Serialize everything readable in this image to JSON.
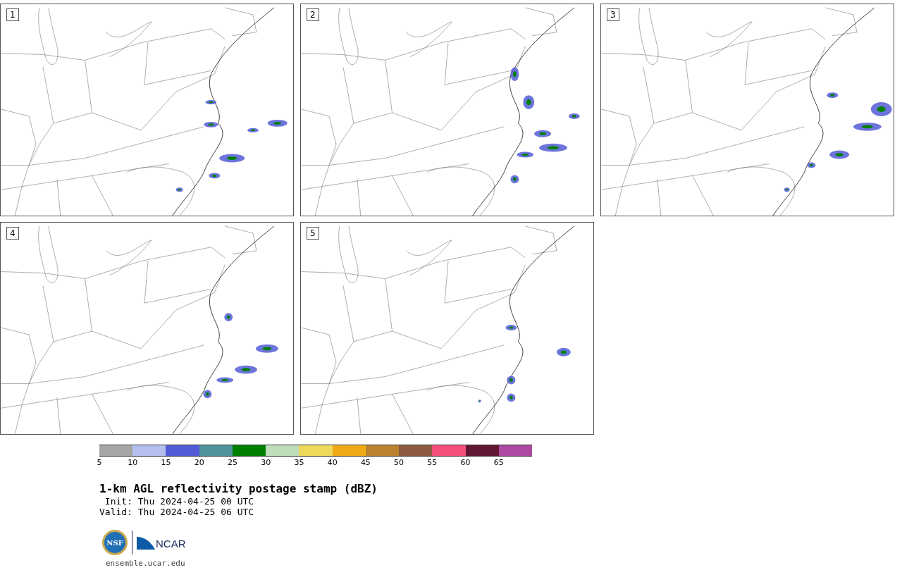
{
  "panels": [
    {
      "label": "1"
    },
    {
      "label": "2"
    },
    {
      "label": "3"
    },
    {
      "label": "4"
    },
    {
      "label": "5"
    }
  ],
  "colorbar": {
    "segments": [
      {
        "color": "#a5a5a5",
        "label": "5"
      },
      {
        "color": "#b4bfee",
        "label": "10"
      },
      {
        "color": "#535cd6",
        "label": "15"
      },
      {
        "color": "#4e9499",
        "label": "20"
      },
      {
        "color": "#008000",
        "label": "25"
      },
      {
        "color": "#bedebb",
        "label": "30"
      },
      {
        "color": "#efd95a",
        "label": "35"
      },
      {
        "color": "#efab16",
        "label": "40"
      },
      {
        "color": "#bb8130",
        "label": "45"
      },
      {
        "color": "#8b5a3f",
        "label": "50"
      },
      {
        "color": "#f54f7b",
        "label": "55"
      },
      {
        "color": "#611734",
        "label": "60"
      },
      {
        "color": "#ac4aa1",
        "label": "65"
      }
    ]
  },
  "title": "1-km AGL reflectivity postage stamp (dBZ)",
  "init": " Init: Thu 2024-04-25 00 UTC",
  "valid": "Valid: Thu 2024-04-25 06 UTC",
  "logo": {
    "nsf": "NSF",
    "ncar": "NCAR"
  },
  "footer": "ensemble.ucar.edu"
}
